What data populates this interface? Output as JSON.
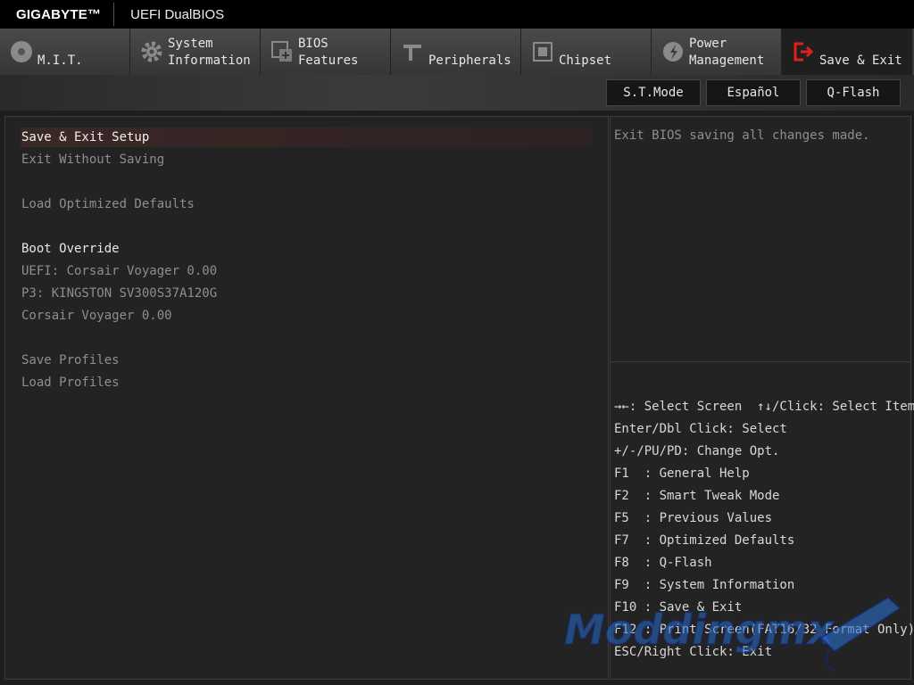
{
  "header": {
    "brand": "GIGABYTE™",
    "product": "UEFI DualBIOS"
  },
  "tabs": [
    {
      "label": "M.I.T.",
      "icon": "disc-icon"
    },
    {
      "label": "System\nInformation",
      "icon": "gear-icon"
    },
    {
      "label": "BIOS\nFeatures",
      "icon": "chip-plus-icon"
    },
    {
      "label": "Peripherals",
      "icon": "connector-icon"
    },
    {
      "label": "Chipset",
      "icon": "chip-icon"
    },
    {
      "label": "Power\nManagement",
      "icon": "power-leaf-icon"
    },
    {
      "label": "Save & Exit",
      "icon": "exit-icon",
      "active": true
    }
  ],
  "subbar": {
    "st_mode": "S.T.Mode",
    "language": "Español",
    "qflash": "Q-Flash"
  },
  "menu": {
    "save_exit_setup": "Save & Exit Setup",
    "exit_without_saving": "Exit Without Saving",
    "load_optimized_defaults": "Load Optimized Defaults",
    "boot_override": "Boot Override",
    "boot_uefi_corsair": "UEFI: Corsair Voyager 0.00",
    "boot_p3_kingston": "P3: KINGSTON SV300S37A120G",
    "boot_corsair": "Corsair Voyager 0.00",
    "save_profiles": "Save Profiles",
    "load_profiles": "Load Profiles"
  },
  "help_text": "Exit BIOS saving all changes made.",
  "key_help": [
    "→←: Select Screen  ↑↓/Click: Select Item",
    "Enter/Dbl Click: Select",
    "+/-/PU/PD: Change Opt.",
    "F1  : General Help",
    "F2  : Smart Tweak Mode",
    "F5  : Previous Values",
    "F7  : Optimized Defaults",
    "F8  : Q-Flash",
    "F9  : System Information",
    "F10 : Save & Exit",
    "F12 : Print Screen(FAT16/32 Format Only)",
    "ESC/Right Click: Exit"
  ],
  "watermark": "Moddingmx",
  "colors": {
    "accent_red": "#e0201c",
    "selected_bg": "#3a2826"
  }
}
